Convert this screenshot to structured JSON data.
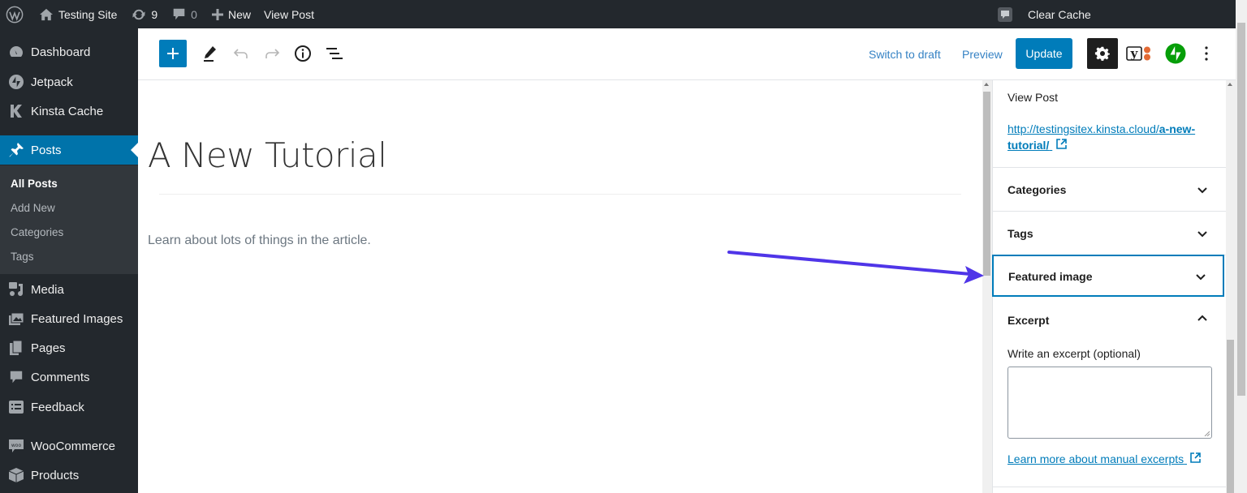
{
  "admin_bar": {
    "site_name": "Testing Site",
    "updates_count": "9",
    "comments_count": "0",
    "new_label": "New",
    "view_post_label": "View Post",
    "clear_cache_label": "Clear Cache"
  },
  "sidebar": {
    "items": [
      {
        "label": "Dashboard",
        "icon": "dashboard-icon"
      },
      {
        "label": "Jetpack",
        "icon": "jetpack-icon"
      },
      {
        "label": "Kinsta Cache",
        "icon": "kinsta-icon"
      },
      {
        "label": "Posts",
        "icon": "pin-icon",
        "active": true
      },
      {
        "label": "Media",
        "icon": "media-icon"
      },
      {
        "label": "Featured Images",
        "icon": "images-icon"
      },
      {
        "label": "Pages",
        "icon": "pages-icon"
      },
      {
        "label": "Comments",
        "icon": "comment-icon"
      },
      {
        "label": "Feedback",
        "icon": "feedback-icon"
      },
      {
        "label": "WooCommerce",
        "icon": "woo-icon"
      },
      {
        "label": "Products",
        "icon": "products-icon"
      }
    ],
    "submenu": [
      {
        "label": "All Posts",
        "current": true
      },
      {
        "label": "Add New"
      },
      {
        "label": "Categories"
      },
      {
        "label": "Tags"
      }
    ]
  },
  "editor_header": {
    "switch_to_draft": "Switch to draft",
    "preview": "Preview",
    "update": "Update"
  },
  "post": {
    "title": "A New Tutorial",
    "paragraph": "Learn about lots of things in the article."
  },
  "settings_panel": {
    "view_post_label": "View Post",
    "permalink_prefix": "http://testingsitex.kinsta.cloud/",
    "permalink_slug_1": "a-new-",
    "permalink_slug_2": "tutorial/",
    "sections": {
      "categories": "Categories",
      "tags": "Tags",
      "featured_image": "Featured image",
      "excerpt": "Excerpt"
    },
    "excerpt_label": "Write an excerpt (optional)",
    "excerpt_value": "",
    "excerpt_help_link": "Learn more about manual excerpts"
  },
  "colors": {
    "accent": "#007cba",
    "admin_bg": "#23282d",
    "annotation_arrow": "#4f35e8",
    "jetpack_green": "#069e08",
    "yoast_orange": "#e36a34"
  }
}
